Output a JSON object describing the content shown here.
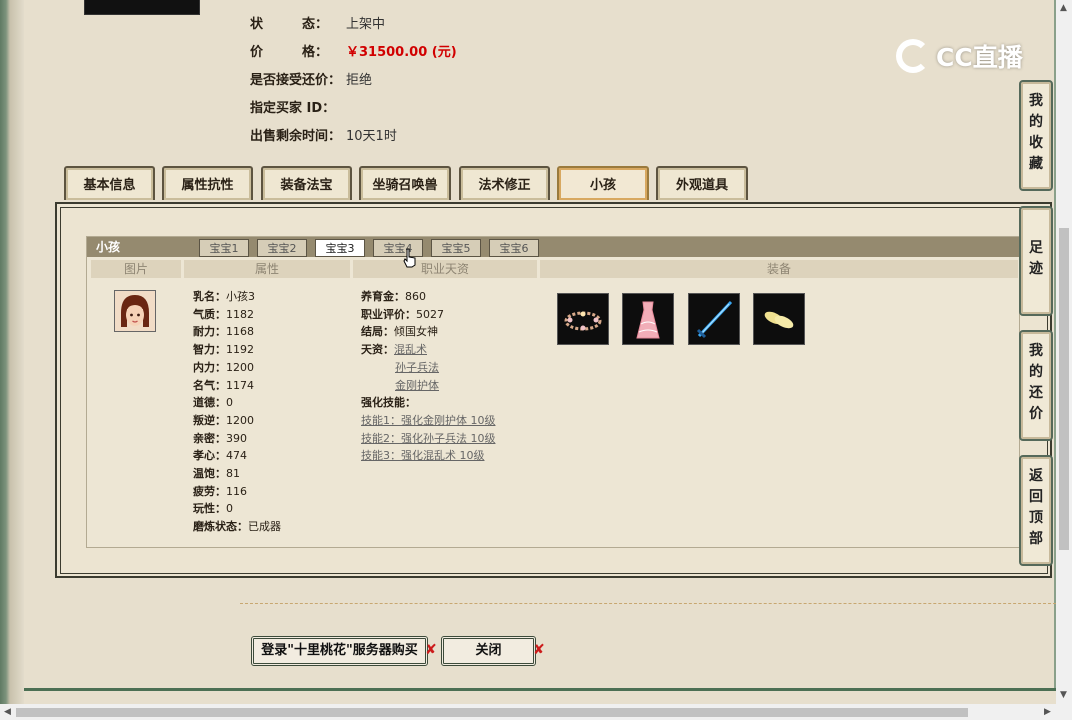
{
  "seller_info": {
    "status_label": "状　　　态：",
    "status_value": "上架中",
    "price_label": "价　　　格：",
    "price_value": "￥31500.00 (元)",
    "accept_bargain_label": "是否接受还价：",
    "accept_bargain_value": "拒绝",
    "designated_buyer_label": "指定买家 ID：",
    "designated_buyer_value": "",
    "time_left_label": "出售剩余时间：",
    "time_left_value": "10天1时"
  },
  "logo_text": "CC直播",
  "tabs": [
    "基本信息",
    "属性抗性",
    "装备法宝",
    "坐骑召唤兽",
    "法术修正",
    "小孩",
    "外观道具"
  ],
  "active_tab": "小孩",
  "child_panel": {
    "title": "小孩",
    "baby_tabs": [
      "宝宝1",
      "宝宝2",
      "宝宝3",
      "宝宝4",
      "宝宝5",
      "宝宝6"
    ],
    "active_baby": "宝宝3",
    "columns": [
      "图片",
      "属性",
      "职业天资",
      "装备"
    ],
    "attributes": [
      {
        "k": "乳名：",
        "v": "小孩3"
      },
      {
        "k": "气质：",
        "v": "1182"
      },
      {
        "k": "耐力：",
        "v": "1168"
      },
      {
        "k": "智力：",
        "v": "1192"
      },
      {
        "k": "内力：",
        "v": "1200"
      },
      {
        "k": "名气：",
        "v": "1174"
      },
      {
        "k": "道德：",
        "v": "0"
      },
      {
        "k": "叛逆：",
        "v": "1200"
      },
      {
        "k": "亲密：",
        "v": "390"
      },
      {
        "k": "孝心：",
        "v": "474"
      },
      {
        "k": "温饱：",
        "v": "81"
      },
      {
        "k": "疲劳：",
        "v": "116"
      },
      {
        "k": "玩性：",
        "v": "0"
      },
      {
        "k": "磨炼状态：",
        "v": "已成器"
      }
    ],
    "career": {
      "nurture_label": "养育金：",
      "nurture_value": "860",
      "rating_label": "职业评价：",
      "rating_value": "5027",
      "ending_label": "结局：",
      "ending_value": "倾国女神",
      "talent_label": "天资：",
      "talents": [
        "混乱术",
        "孙子兵法",
        "金刚护体"
      ],
      "enhance_label": "强化技能：",
      "skills": [
        "技能1：强化金刚护体 10级",
        "技能2：强化孙子兵法 10级",
        "技能3：强化混乱术 10级"
      ]
    },
    "equipment_icons": [
      "flower-crown-icon",
      "pink-dress-icon",
      "blue-sword-icon",
      "golden-shoes-icon"
    ]
  },
  "side_nav": [
    "我的收藏",
    "足迹",
    "我的还价",
    "返回顶部"
  ],
  "buttons": {
    "buy_login": "登录\"十里桃花\"服务器购买",
    "close": "关闭"
  }
}
